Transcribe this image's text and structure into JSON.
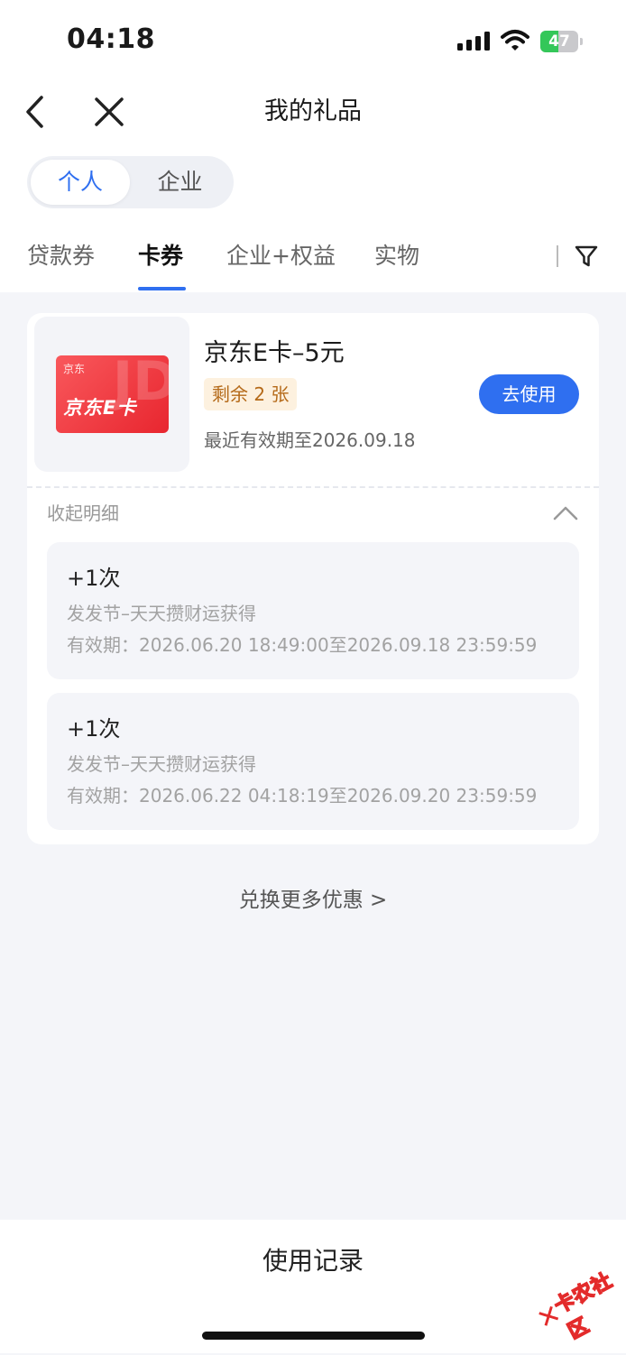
{
  "status_bar": {
    "time": "04:18",
    "battery": "47",
    "battery_level": 0.47
  },
  "header": {
    "title": "我的礼品"
  },
  "segment": {
    "items": [
      "个人",
      "企业"
    ],
    "selected": "个人"
  },
  "tabs": {
    "items": [
      "贷款券",
      "卡券",
      "企业+权益",
      "实物"
    ],
    "selected": "卡券"
  },
  "gift": {
    "card_logo_small": "京东",
    "card_logo_main": "京东E卡",
    "card_deco": "JD",
    "name": "京东E卡–5元",
    "remaining": "剩余 2 张",
    "expiry": "最近有效期至2026.09.18",
    "use_button": "去使用"
  },
  "details": {
    "collapse_label": "收起明细",
    "items": [
      {
        "title": "+1次",
        "source": "发发节–天天攒财运获得",
        "validity": "有效期：2026.06.20 18:49:00至2026.09.18 23:59:59"
      },
      {
        "title": "+1次",
        "source": "发发节–天天攒财运获得",
        "validity": "有效期：2026.06.22 04:18:19至2026.09.20 23:59:59"
      }
    ]
  },
  "more_link": "兑换更多优惠 >",
  "bottom": {
    "label": "使用记录"
  },
  "watermark": {
    "text": "卡农社区"
  },
  "colors": {
    "accent": "#2f6ff0",
    "badge_bg": "#fdf1df",
    "badge_text": "#b56a19",
    "battery_green": "#34c759"
  }
}
